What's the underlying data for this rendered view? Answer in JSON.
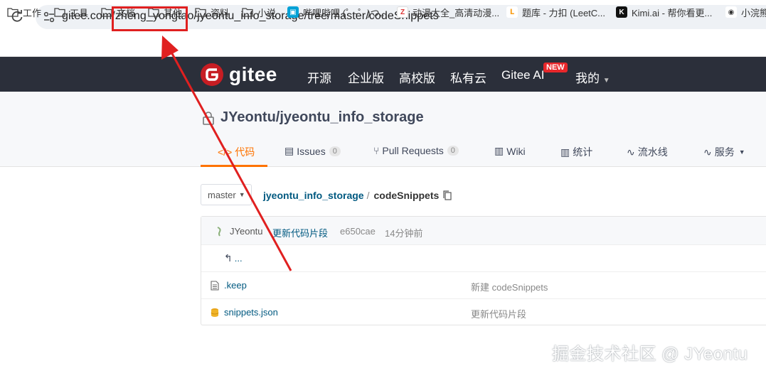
{
  "browser": {
    "url_prefix": "gitee.com/",
    "url_highlight": "zheng_yongtao",
    "url_suffix": "/jyeontu_info_storage/tree/master/codeSnippets"
  },
  "bookmarks": [
    {
      "label": "工作",
      "icon": "folder-icon"
    },
    {
      "label": "工具",
      "icon": "folder-icon"
    },
    {
      "label": "文档",
      "icon": "folder-icon"
    },
    {
      "label": "其他",
      "icon": "folder-icon"
    },
    {
      "label": "资料",
      "icon": "folder-icon"
    },
    {
      "label": "小说",
      "icon": "folder-icon"
    },
    {
      "label": "哔哩哔哩 (゜-゜)つ...",
      "icon": "bilibili-icon"
    },
    {
      "label": "动漫大全_高清动漫...",
      "icon": "anime-site-icon"
    },
    {
      "label": "题库 - 力扣 (LeetC...",
      "icon": "leetcode-icon"
    },
    {
      "label": "Kimi.ai - 帮你看更...",
      "icon": "kimi-icon"
    },
    {
      "label": "小浣熊",
      "icon": "raccoon-icon"
    }
  ],
  "gitee_nav": {
    "logo_text": "gitee",
    "items": [
      "开源",
      "企业版",
      "高校版",
      "私有云",
      "Gitee AI",
      "我的"
    ],
    "new_badge": "NEW"
  },
  "repo": {
    "title": "JYeontu/jyeontu_info_storage",
    "tabs": [
      {
        "label": "代码",
        "count": null,
        "icon": "code-icon"
      },
      {
        "label": "Issues",
        "count": "0",
        "icon": "issues-icon"
      },
      {
        "label": "Pull Requests",
        "count": "0",
        "icon": "pull-request-icon"
      },
      {
        "label": "Wiki",
        "count": null,
        "icon": "wiki-icon"
      },
      {
        "label": "统计",
        "count": null,
        "icon": "stats-icon"
      },
      {
        "label": "流水线",
        "count": null,
        "icon": "pipeline-icon"
      },
      {
        "label": "服务",
        "count": null,
        "icon": "service-icon"
      }
    ]
  },
  "branch": {
    "name": "master"
  },
  "breadcrumb": {
    "repo": "jyeontu_info_storage",
    "sep": "/",
    "current": "codeSnippets"
  },
  "commit": {
    "user": "JYeontu",
    "message": "更新代码片段",
    "hash": "e650cae",
    "time": "14分钟前"
  },
  "files": {
    "back_label": "...",
    "items": [
      {
        "name": ".keep",
        "desc": "新建 codeSnippets",
        "icon": "file-icon"
      },
      {
        "name": "snippets.json",
        "desc": "更新代码片段",
        "icon": "json-file-icon"
      }
    ]
  },
  "watermark": "掘金技术社区 @ JYeontu",
  "colors": {
    "accent": "#fe7300",
    "annotation": "#e02020",
    "header_bg": "#2b2f3a",
    "link": "#005980"
  }
}
